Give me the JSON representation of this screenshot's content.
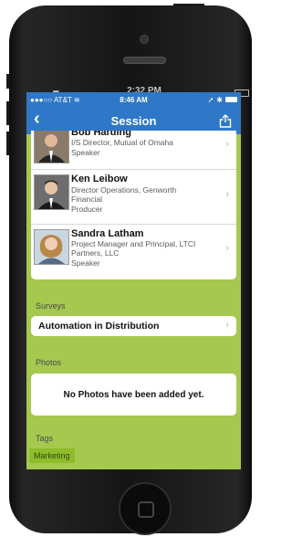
{
  "device": {
    "outer_time": "2:32 PM"
  },
  "status_bar": {
    "carrier": "●●●○○ AT&T",
    "time": "8:46 AM"
  },
  "nav": {
    "title": "Session",
    "back_icon": "chevron-left-icon",
    "share_icon": "share-icon"
  },
  "speakers": [
    {
      "name": "Bob Harding",
      "title": "I/S Director, Mutual of Omaha",
      "role": "Speaker"
    },
    {
      "name": "Ken Leibow",
      "title": "Director Operations, Genworth Financial",
      "role": "Producer"
    },
    {
      "name": "Sandra Latham",
      "title": "Project Manager and Principal, LTCI Partners, LLC",
      "role": "Speaker"
    }
  ],
  "surveys": {
    "label": "Surveys",
    "items": [
      "Automation in Distribution"
    ]
  },
  "photos": {
    "label": "Photos",
    "empty_text": "No Photos have been added yet."
  },
  "tags": {
    "label": "Tags",
    "items": [
      "Marketing"
    ]
  },
  "colors": {
    "nav_blue": "#2f78c7",
    "background_green": "#a5c84f",
    "tag_green": "#8fbd2a"
  }
}
